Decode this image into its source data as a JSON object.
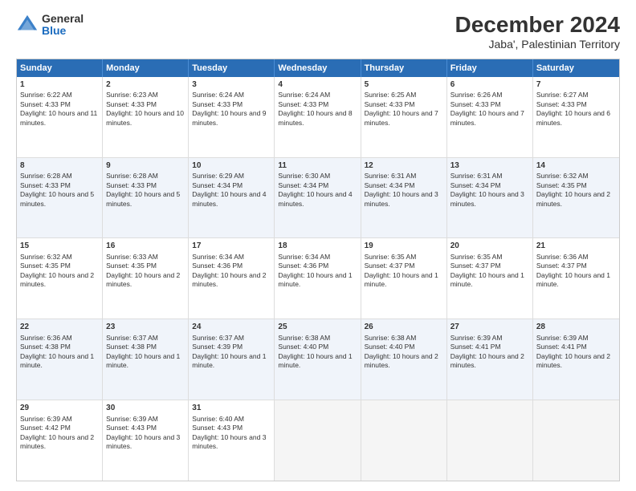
{
  "logo": {
    "general": "General",
    "blue": "Blue"
  },
  "title": "December 2024",
  "subtitle": "Jaba', Palestinian Territory",
  "header_days": [
    "Sunday",
    "Monday",
    "Tuesday",
    "Wednesday",
    "Thursday",
    "Friday",
    "Saturday"
  ],
  "rows": [
    [
      {
        "day": "",
        "empty": true
      },
      {
        "day": "2",
        "sunrise": "Sunrise: 6:23 AM",
        "sunset": "Sunset: 4:33 PM",
        "daylight": "Daylight: 10 hours and 10 minutes."
      },
      {
        "day": "3",
        "sunrise": "Sunrise: 6:24 AM",
        "sunset": "Sunset: 4:33 PM",
        "daylight": "Daylight: 10 hours and 9 minutes."
      },
      {
        "day": "4",
        "sunrise": "Sunrise: 6:24 AM",
        "sunset": "Sunset: 4:33 PM",
        "daylight": "Daylight: 10 hours and 8 minutes."
      },
      {
        "day": "5",
        "sunrise": "Sunrise: 6:25 AM",
        "sunset": "Sunset: 4:33 PM",
        "daylight": "Daylight: 10 hours and 7 minutes."
      },
      {
        "day": "6",
        "sunrise": "Sunrise: 6:26 AM",
        "sunset": "Sunset: 4:33 PM",
        "daylight": "Daylight: 10 hours and 7 minutes."
      },
      {
        "day": "7",
        "sunrise": "Sunrise: 6:27 AM",
        "sunset": "Sunset: 4:33 PM",
        "daylight": "Daylight: 10 hours and 6 minutes."
      }
    ],
    [
      {
        "day": "1",
        "sunrise": "Sunrise: 6:22 AM",
        "sunset": "Sunset: 4:33 PM",
        "daylight": "Daylight: 10 hours and 11 minutes."
      },
      {
        "day": "9",
        "sunrise": "Sunrise: 6:28 AM",
        "sunset": "Sunset: 4:33 PM",
        "daylight": "Daylight: 10 hours and 5 minutes."
      },
      {
        "day": "10",
        "sunrise": "Sunrise: 6:29 AM",
        "sunset": "Sunset: 4:34 PM",
        "daylight": "Daylight: 10 hours and 4 minutes."
      },
      {
        "day": "11",
        "sunrise": "Sunrise: 6:30 AM",
        "sunset": "Sunset: 4:34 PM",
        "daylight": "Daylight: 10 hours and 4 minutes."
      },
      {
        "day": "12",
        "sunrise": "Sunrise: 6:31 AM",
        "sunset": "Sunset: 4:34 PM",
        "daylight": "Daylight: 10 hours and 3 minutes."
      },
      {
        "day": "13",
        "sunrise": "Sunrise: 6:31 AM",
        "sunset": "Sunset: 4:34 PM",
        "daylight": "Daylight: 10 hours and 3 minutes."
      },
      {
        "day": "14",
        "sunrise": "Sunrise: 6:32 AM",
        "sunset": "Sunset: 4:35 PM",
        "daylight": "Daylight: 10 hours and 2 minutes."
      }
    ],
    [
      {
        "day": "8",
        "sunrise": "Sunrise: 6:28 AM",
        "sunset": "Sunset: 4:33 PM",
        "daylight": "Daylight: 10 hours and 5 minutes."
      },
      {
        "day": "16",
        "sunrise": "Sunrise: 6:33 AM",
        "sunset": "Sunset: 4:35 PM",
        "daylight": "Daylight: 10 hours and 2 minutes."
      },
      {
        "day": "17",
        "sunrise": "Sunrise: 6:34 AM",
        "sunset": "Sunset: 4:36 PM",
        "daylight": "Daylight: 10 hours and 2 minutes."
      },
      {
        "day": "18",
        "sunrise": "Sunrise: 6:34 AM",
        "sunset": "Sunset: 4:36 PM",
        "daylight": "Daylight: 10 hours and 1 minute."
      },
      {
        "day": "19",
        "sunrise": "Sunrise: 6:35 AM",
        "sunset": "Sunset: 4:37 PM",
        "daylight": "Daylight: 10 hours and 1 minute."
      },
      {
        "day": "20",
        "sunrise": "Sunrise: 6:35 AM",
        "sunset": "Sunset: 4:37 PM",
        "daylight": "Daylight: 10 hours and 1 minute."
      },
      {
        "day": "21",
        "sunrise": "Sunrise: 6:36 AM",
        "sunset": "Sunset: 4:37 PM",
        "daylight": "Daylight: 10 hours and 1 minute."
      }
    ],
    [
      {
        "day": "15",
        "sunrise": "Sunrise: 6:32 AM",
        "sunset": "Sunset: 4:35 PM",
        "daylight": "Daylight: 10 hours and 2 minutes."
      },
      {
        "day": "23",
        "sunrise": "Sunrise: 6:37 AM",
        "sunset": "Sunset: 4:38 PM",
        "daylight": "Daylight: 10 hours and 1 minute."
      },
      {
        "day": "24",
        "sunrise": "Sunrise: 6:37 AM",
        "sunset": "Sunset: 4:39 PM",
        "daylight": "Daylight: 10 hours and 1 minute."
      },
      {
        "day": "25",
        "sunrise": "Sunrise: 6:38 AM",
        "sunset": "Sunset: 4:40 PM",
        "daylight": "Daylight: 10 hours and 1 minute."
      },
      {
        "day": "26",
        "sunrise": "Sunrise: 6:38 AM",
        "sunset": "Sunset: 4:40 PM",
        "daylight": "Daylight: 10 hours and 2 minutes."
      },
      {
        "day": "27",
        "sunrise": "Sunrise: 6:39 AM",
        "sunset": "Sunset: 4:41 PM",
        "daylight": "Daylight: 10 hours and 2 minutes."
      },
      {
        "day": "28",
        "sunrise": "Sunrise: 6:39 AM",
        "sunset": "Sunset: 4:41 PM",
        "daylight": "Daylight: 10 hours and 2 minutes."
      }
    ],
    [
      {
        "day": "22",
        "sunrise": "Sunrise: 6:36 AM",
        "sunset": "Sunset: 4:38 PM",
        "daylight": "Daylight: 10 hours and 1 minute."
      },
      {
        "day": "30",
        "sunrise": "Sunrise: 6:39 AM",
        "sunset": "Sunset: 4:43 PM",
        "daylight": "Daylight: 10 hours and 3 minutes."
      },
      {
        "day": "31",
        "sunrise": "Sunrise: 6:40 AM",
        "sunset": "Sunset: 4:43 PM",
        "daylight": "Daylight: 10 hours and 3 minutes."
      },
      {
        "day": "",
        "empty": true
      },
      {
        "day": "",
        "empty": true
      },
      {
        "day": "",
        "empty": true
      },
      {
        "day": "",
        "empty": true
      }
    ],
    [
      {
        "day": "29",
        "sunrise": "Sunrise: 6:39 AM",
        "sunset": "Sunset: 4:42 PM",
        "daylight": "Daylight: 10 hours and 2 minutes."
      },
      {
        "day": "",
        "empty": true
      },
      {
        "day": "",
        "empty": true
      },
      {
        "day": "",
        "empty": true
      },
      {
        "day": "",
        "empty": true
      },
      {
        "day": "",
        "empty": true
      },
      {
        "day": "",
        "empty": true
      }
    ]
  ]
}
